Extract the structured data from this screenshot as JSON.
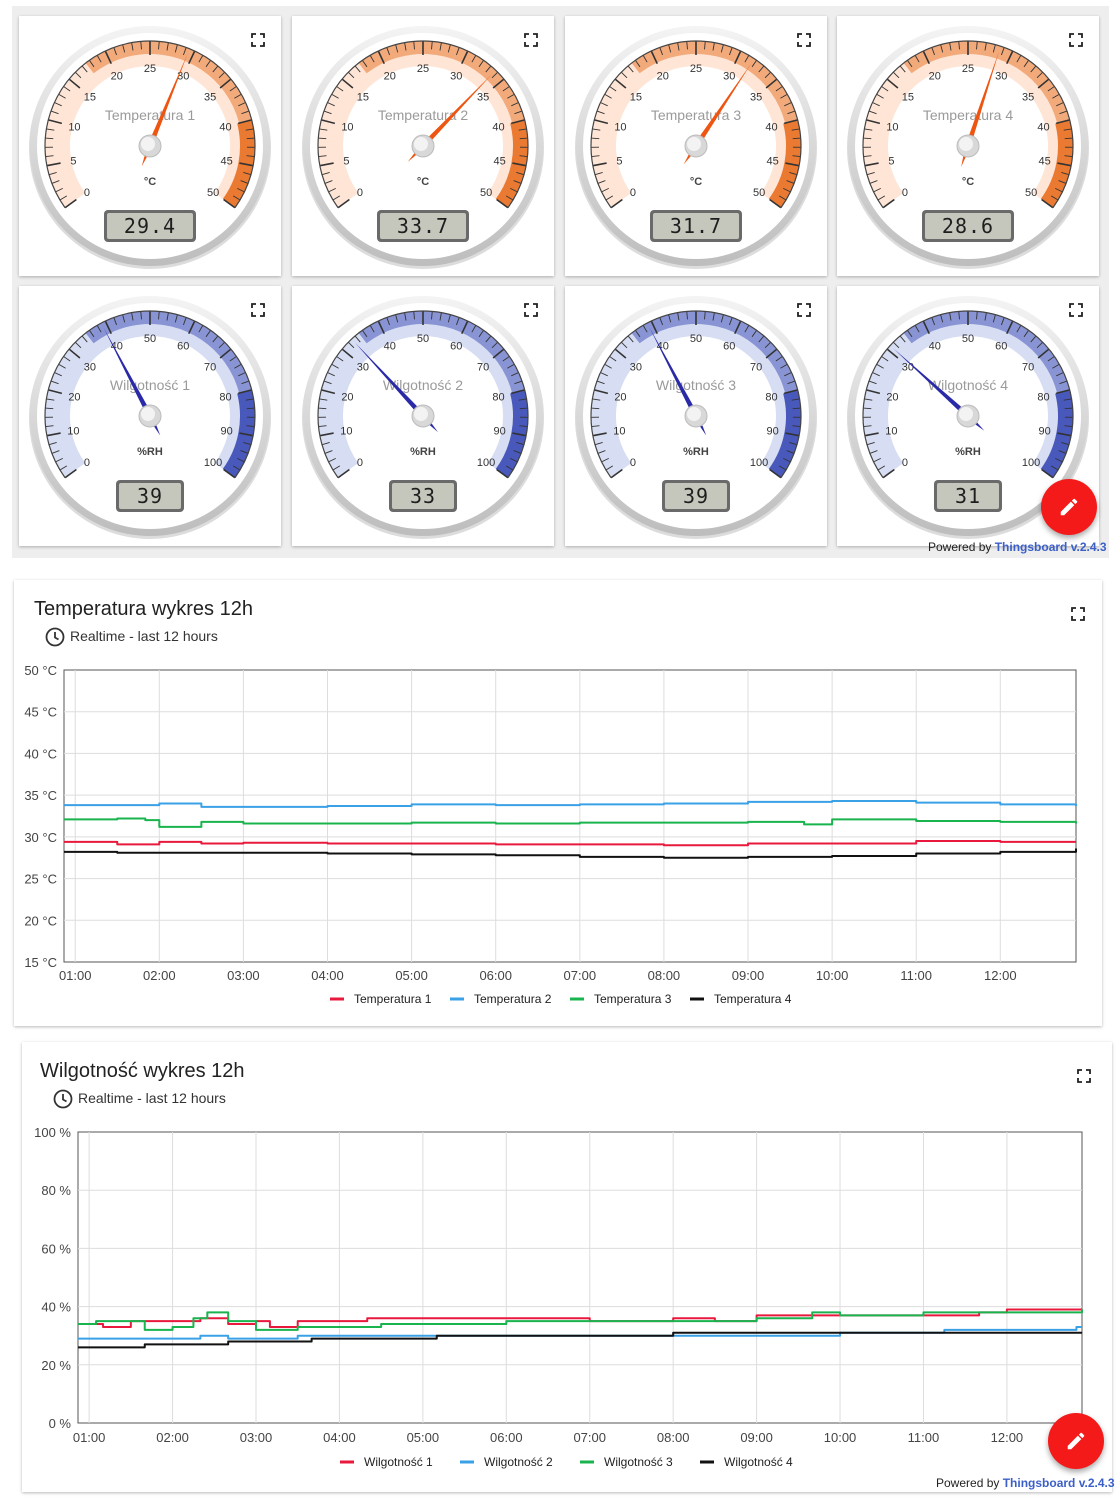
{
  "gauges_temperature": [
    {
      "title": "Temperatura 1",
      "value": 29.4,
      "display": "29.4",
      "unit": "°C"
    },
    {
      "title": "Temperatura 2",
      "value": 33.7,
      "display": "33.7",
      "unit": "°C"
    },
    {
      "title": "Temperatura 3",
      "value": 31.7,
      "display": "31.7",
      "unit": "°C"
    },
    {
      "title": "Temperatura 4",
      "value": 28.6,
      "display": "28.6",
      "unit": "°C"
    }
  ],
  "temperature_scale": {
    "min": 0,
    "max": 50,
    "ticks": [
      "0",
      "5",
      "10",
      "15",
      "20",
      "25",
      "30",
      "35",
      "40",
      "45",
      "50"
    ]
  },
  "gauges_humidity": [
    {
      "title": "Wilgotność 1",
      "value": 39,
      "display": "39",
      "unit": "%RH"
    },
    {
      "title": "Wilgotność 2",
      "value": 33,
      "display": "33",
      "unit": "%RH"
    },
    {
      "title": "Wilgotność 3",
      "value": 39,
      "display": "39",
      "unit": "%RH"
    },
    {
      "title": "Wilgotność 4",
      "value": 31,
      "display": "31",
      "unit": "%RH"
    }
  ],
  "humidity_scale": {
    "min": 0,
    "max": 100,
    "ticks": [
      "0",
      "10",
      "20",
      "30",
      "40",
      "50",
      "60",
      "70",
      "80",
      "90",
      "100"
    ]
  },
  "colors": {
    "temp_fill": "#ffdcc8",
    "temp_band": "#ea7a32",
    "temp_needle": "#ee5511",
    "hum_fill": "#c9d2ee",
    "hum_band": "#4858bb",
    "hum_needle": "#2a2aa8",
    "fab": "#f41a1a",
    "brand_link": "#3b5fc9",
    "temp1": "#e8193c",
    "temp2": "#3aa1e6",
    "temp3": "#19b44e",
    "temp4": "#111111"
  },
  "icons": {
    "fullscreen": "fullscreen-icon",
    "clock": "clock-icon",
    "edit": "pencil-icon"
  },
  "powered_by": {
    "prefix": "Powered by",
    "brand": "Thingsboard v.2.4.3"
  },
  "charts": [
    {
      "title": "Temperatura wykres 12h",
      "subtitle": "Realtime - last 12 hours",
      "chart_data": {
        "type": "line",
        "x_ticks": [
          "01:00",
          "02:00",
          "03:00",
          "04:00",
          "05:00",
          "06:00",
          "07:00",
          "08:00",
          "09:00",
          "10:00",
          "11:00",
          "12:00"
        ],
        "xlim": [
          "00:52",
          "12:54"
        ],
        "ylim": [
          15,
          50
        ],
        "y_ticks": [
          "15 °C",
          "20 °C",
          "25 °C",
          "30 °C",
          "35 °C",
          "40 °C",
          "45 °C",
          "50 °C"
        ],
        "grid": true,
        "legend_position": "bottom",
        "series": [
          {
            "name": "Temperatura 1",
            "x": [
              "00:52",
              "01:30",
              "02:00",
              "02:30",
              "03:00",
              "04:00",
              "05:00",
              "06:00",
              "07:00",
              "08:00",
              "09:00",
              "10:00",
              "11:00",
              "12:00",
              "12:54"
            ],
            "values": [
              29.4,
              29.1,
              29.4,
              29.2,
              29.3,
              29.2,
              29.2,
              29.1,
              29.1,
              29.0,
              29.2,
              29.2,
              29.5,
              29.4,
              29.4
            ]
          },
          {
            "name": "Temperatura 2",
            "x": [
              "00:52",
              "01:30",
              "02:00",
              "02:30",
              "03:00",
              "04:00",
              "05:00",
              "06:00",
              "07:00",
              "08:00",
              "09:00",
              "10:00",
              "11:00",
              "12:00",
              "12:54"
            ],
            "values": [
              33.8,
              33.8,
              34.0,
              33.6,
              33.6,
              33.7,
              33.9,
              33.8,
              33.9,
              34.0,
              34.2,
              34.3,
              34.1,
              33.9,
              33.7
            ]
          },
          {
            "name": "Temperatura 3",
            "x": [
              "00:52",
              "01:30",
              "01:50",
              "02:00",
              "02:30",
              "03:00",
              "04:00",
              "05:00",
              "06:00",
              "07:00",
              "08:00",
              "09:00",
              "09:40",
              "10:00",
              "11:00",
              "12:00",
              "12:54"
            ],
            "values": [
              32.1,
              32.2,
              32.0,
              31.2,
              31.8,
              31.6,
              31.6,
              31.7,
              31.6,
              31.7,
              31.7,
              31.8,
              31.5,
              32.1,
              31.9,
              31.8,
              31.6
            ]
          },
          {
            "name": "Temperatura 4",
            "x": [
              "00:52",
              "01:30",
              "02:00",
              "03:00",
              "04:00",
              "05:00",
              "06:00",
              "07:00",
              "08:00",
              "09:00",
              "10:00",
              "11:00",
              "12:00",
              "12:54"
            ],
            "values": [
              28.2,
              28.1,
              28.1,
              28.1,
              28.0,
              27.9,
              27.8,
              27.6,
              27.5,
              27.6,
              27.7,
              28.0,
              28.2,
              28.6
            ]
          }
        ]
      }
    },
    {
      "title": "Wilgotność wykres 12h",
      "subtitle": "Realtime - last 12 hours",
      "chart_data": {
        "type": "line",
        "x_ticks": [
          "01:00",
          "02:00",
          "03:00",
          "04:00",
          "05:00",
          "06:00",
          "07:00",
          "08:00",
          "09:00",
          "10:00",
          "11:00",
          "12:00"
        ],
        "xlim": [
          "00:52",
          "12:54"
        ],
        "ylim": [
          0,
          100
        ],
        "y_ticks": [
          "0 %",
          "20 %",
          "40 %",
          "60 %",
          "80 %",
          "100 %"
        ],
        "grid": true,
        "legend_position": "bottom",
        "series": [
          {
            "name": "Wilgotność 1",
            "x": [
              "00:52",
              "01:10",
              "01:30",
              "02:00",
              "02:20",
              "02:40",
              "03:00",
              "03:10",
              "03:30",
              "04:00",
              "04:20",
              "05:00",
              "06:00",
              "07:00",
              "08:00",
              "08:30",
              "09:00",
              "09:30",
              "10:00",
              "11:00",
              "11:40",
              "12:00",
              "12:54"
            ],
            "values": [
              34,
              33,
              35,
              35,
              36,
              34,
              35,
              33,
              35,
              35,
              36,
              36,
              36,
              35,
              36,
              35,
              37,
              37,
              37,
              37,
              38,
              39,
              39
            ]
          },
          {
            "name": "Wilgotność 2",
            "x": [
              "00:52",
              "01:30",
              "02:00",
              "02:20",
              "02:40",
              "03:00",
              "03:30",
              "04:00",
              "05:00",
              "06:00",
              "07:00",
              "08:00",
              "09:00",
              "09:50",
              "10:00",
              "11:00",
              "11:15",
              "12:00",
              "12:50",
              "12:54"
            ],
            "values": [
              29,
              29,
              29,
              30,
              29,
              29,
              30,
              30,
              30,
              30,
              30,
              30,
              30,
              30,
              31,
              31,
              32,
              32,
              33,
              33
            ]
          },
          {
            "name": "Wilgotność 3",
            "x": [
              "00:52",
              "01:05",
              "01:30",
              "01:40",
              "02:00",
              "02:15",
              "02:25",
              "02:40",
              "03:00",
              "03:30",
              "04:00",
              "04:30",
              "05:00",
              "06:00",
              "07:00",
              "08:00",
              "08:40",
              "09:00",
              "09:40",
              "10:00",
              "11:00",
              "12:00",
              "12:30",
              "12:54"
            ],
            "values": [
              34,
              35,
              35,
              32,
              33,
              36,
              38,
              35,
              32,
              33,
              33,
              34,
              34,
              35,
              35,
              35,
              35,
              36,
              38,
              37,
              38,
              38,
              38,
              39
            ]
          },
          {
            "name": "Wilgotność 4",
            "x": [
              "00:52",
              "01:20",
              "01:40",
              "02:00",
              "02:20",
              "02:40",
              "03:00",
              "03:20",
              "03:40",
              "04:00",
              "05:00",
              "05:10",
              "06:00",
              "07:00",
              "08:00",
              "09:00",
              "10:00",
              "11:00",
              "12:00",
              "12:54"
            ],
            "values": [
              26,
              26,
              27,
              27,
              27,
              28,
              28,
              28,
              29,
              29,
              29,
              30,
              30,
              30,
              31,
              31,
              31,
              31,
              31,
              31
            ]
          }
        ]
      }
    }
  ]
}
